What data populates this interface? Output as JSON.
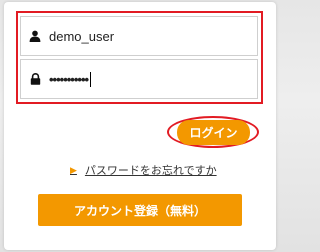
{
  "login_form": {
    "username_value": "demo_user",
    "password_masked": "•••••••••••",
    "login_label": "ログイン",
    "forgot_label": "パスワードをお忘れですか",
    "register_label": "アカウント登録（無料）"
  },
  "icons": {
    "username": "user-icon",
    "password": "lock-icon",
    "forgot_bullet": "triangle-right-icon"
  },
  "colors": {
    "accent_orange": "#f39800",
    "highlight_red": "#e21b23",
    "border_gray": "#cfcfcf"
  }
}
